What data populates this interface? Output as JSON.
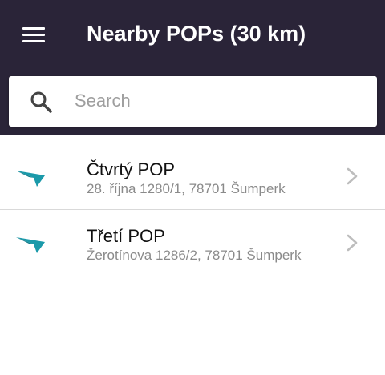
{
  "header": {
    "title": "Nearby POPs (30 km)",
    "menu_icon": "menu-icon",
    "background": "#2a2438"
  },
  "search": {
    "placeholder": "Search",
    "value": "",
    "icon": "search-icon"
  },
  "list": {
    "items": [
      {
        "title": "Čtvrtý POP",
        "address": "28. října 1280/1, 78701 Šumperk",
        "icon": "pop-marker-icon",
        "chevron": "chevron-right-icon"
      },
      {
        "title": "Třetí POP",
        "address": "Žerotínova 1286/2, 78701 Šumperk",
        "icon": "pop-marker-icon",
        "chevron": "chevron-right-icon"
      }
    ],
    "accent_color": "#1b9aaa"
  }
}
